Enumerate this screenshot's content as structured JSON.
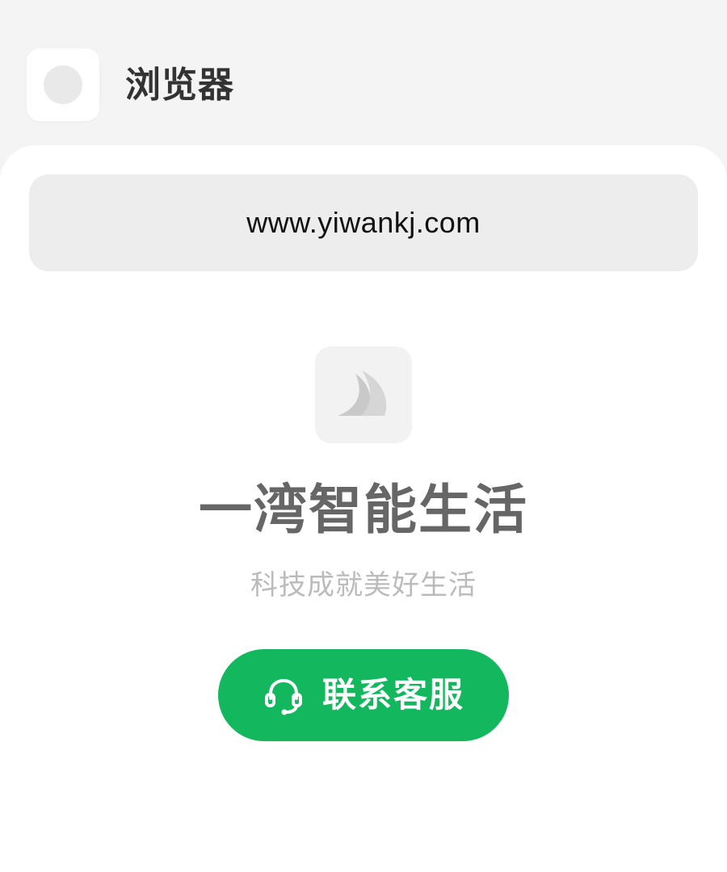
{
  "header": {
    "app_name": "浏览器"
  },
  "url_bar": {
    "url": "www.yiwankj.com"
  },
  "brand": {
    "title": "一湾智能生活",
    "subtitle": "科技成就美好生活"
  },
  "contact_button": {
    "label": "联系客服",
    "icon": "headset-icon"
  },
  "colors": {
    "accent": "#12b75e",
    "background": "#f4f4f4",
    "sheet": "#ffffff",
    "url_bar": "#ededed",
    "title": "#666666",
    "subtitle": "#bbbbbb"
  }
}
